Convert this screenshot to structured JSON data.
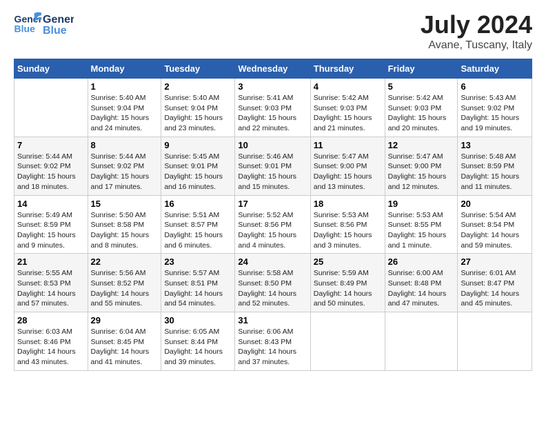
{
  "header": {
    "logo_general": "General",
    "logo_blue": "Blue",
    "month": "July 2024",
    "location": "Avane, Tuscany, Italy"
  },
  "days_of_week": [
    "Sunday",
    "Monday",
    "Tuesday",
    "Wednesday",
    "Thursday",
    "Friday",
    "Saturday"
  ],
  "weeks": [
    [
      {
        "day": "",
        "sunrise": "",
        "sunset": "",
        "daylight": ""
      },
      {
        "day": "1",
        "sunrise": "Sunrise: 5:40 AM",
        "sunset": "Sunset: 9:04 PM",
        "daylight": "Daylight: 15 hours and 24 minutes."
      },
      {
        "day": "2",
        "sunrise": "Sunrise: 5:40 AM",
        "sunset": "Sunset: 9:04 PM",
        "daylight": "Daylight: 15 hours and 23 minutes."
      },
      {
        "day": "3",
        "sunrise": "Sunrise: 5:41 AM",
        "sunset": "Sunset: 9:03 PM",
        "daylight": "Daylight: 15 hours and 22 minutes."
      },
      {
        "day": "4",
        "sunrise": "Sunrise: 5:42 AM",
        "sunset": "Sunset: 9:03 PM",
        "daylight": "Daylight: 15 hours and 21 minutes."
      },
      {
        "day": "5",
        "sunrise": "Sunrise: 5:42 AM",
        "sunset": "Sunset: 9:03 PM",
        "daylight": "Daylight: 15 hours and 20 minutes."
      },
      {
        "day": "6",
        "sunrise": "Sunrise: 5:43 AM",
        "sunset": "Sunset: 9:02 PM",
        "daylight": "Daylight: 15 hours and 19 minutes."
      }
    ],
    [
      {
        "day": "7",
        "sunrise": "Sunrise: 5:44 AM",
        "sunset": "Sunset: 9:02 PM",
        "daylight": "Daylight: 15 hours and 18 minutes."
      },
      {
        "day": "8",
        "sunrise": "Sunrise: 5:44 AM",
        "sunset": "Sunset: 9:02 PM",
        "daylight": "Daylight: 15 hours and 17 minutes."
      },
      {
        "day": "9",
        "sunrise": "Sunrise: 5:45 AM",
        "sunset": "Sunset: 9:01 PM",
        "daylight": "Daylight: 15 hours and 16 minutes."
      },
      {
        "day": "10",
        "sunrise": "Sunrise: 5:46 AM",
        "sunset": "Sunset: 9:01 PM",
        "daylight": "Daylight: 15 hours and 15 minutes."
      },
      {
        "day": "11",
        "sunrise": "Sunrise: 5:47 AM",
        "sunset": "Sunset: 9:00 PM",
        "daylight": "Daylight: 15 hours and 13 minutes."
      },
      {
        "day": "12",
        "sunrise": "Sunrise: 5:47 AM",
        "sunset": "Sunset: 9:00 PM",
        "daylight": "Daylight: 15 hours and 12 minutes."
      },
      {
        "day": "13",
        "sunrise": "Sunrise: 5:48 AM",
        "sunset": "Sunset: 8:59 PM",
        "daylight": "Daylight: 15 hours and 11 minutes."
      }
    ],
    [
      {
        "day": "14",
        "sunrise": "Sunrise: 5:49 AM",
        "sunset": "Sunset: 8:59 PM",
        "daylight": "Daylight: 15 hours and 9 minutes."
      },
      {
        "day": "15",
        "sunrise": "Sunrise: 5:50 AM",
        "sunset": "Sunset: 8:58 PM",
        "daylight": "Daylight: 15 hours and 8 minutes."
      },
      {
        "day": "16",
        "sunrise": "Sunrise: 5:51 AM",
        "sunset": "Sunset: 8:57 PM",
        "daylight": "Daylight: 15 hours and 6 minutes."
      },
      {
        "day": "17",
        "sunrise": "Sunrise: 5:52 AM",
        "sunset": "Sunset: 8:56 PM",
        "daylight": "Daylight: 15 hours and 4 minutes."
      },
      {
        "day": "18",
        "sunrise": "Sunrise: 5:53 AM",
        "sunset": "Sunset: 8:56 PM",
        "daylight": "Daylight: 15 hours and 3 minutes."
      },
      {
        "day": "19",
        "sunrise": "Sunrise: 5:53 AM",
        "sunset": "Sunset: 8:55 PM",
        "daylight": "Daylight: 15 hours and 1 minute."
      },
      {
        "day": "20",
        "sunrise": "Sunrise: 5:54 AM",
        "sunset": "Sunset: 8:54 PM",
        "daylight": "Daylight: 14 hours and 59 minutes."
      }
    ],
    [
      {
        "day": "21",
        "sunrise": "Sunrise: 5:55 AM",
        "sunset": "Sunset: 8:53 PM",
        "daylight": "Daylight: 14 hours and 57 minutes."
      },
      {
        "day": "22",
        "sunrise": "Sunrise: 5:56 AM",
        "sunset": "Sunset: 8:52 PM",
        "daylight": "Daylight: 14 hours and 55 minutes."
      },
      {
        "day": "23",
        "sunrise": "Sunrise: 5:57 AM",
        "sunset": "Sunset: 8:51 PM",
        "daylight": "Daylight: 14 hours and 54 minutes."
      },
      {
        "day": "24",
        "sunrise": "Sunrise: 5:58 AM",
        "sunset": "Sunset: 8:50 PM",
        "daylight": "Daylight: 14 hours and 52 minutes."
      },
      {
        "day": "25",
        "sunrise": "Sunrise: 5:59 AM",
        "sunset": "Sunset: 8:49 PM",
        "daylight": "Daylight: 14 hours and 50 minutes."
      },
      {
        "day": "26",
        "sunrise": "Sunrise: 6:00 AM",
        "sunset": "Sunset: 8:48 PM",
        "daylight": "Daylight: 14 hours and 47 minutes."
      },
      {
        "day": "27",
        "sunrise": "Sunrise: 6:01 AM",
        "sunset": "Sunset: 8:47 PM",
        "daylight": "Daylight: 14 hours and 45 minutes."
      }
    ],
    [
      {
        "day": "28",
        "sunrise": "Sunrise: 6:03 AM",
        "sunset": "Sunset: 8:46 PM",
        "daylight": "Daylight: 14 hours and 43 minutes."
      },
      {
        "day": "29",
        "sunrise": "Sunrise: 6:04 AM",
        "sunset": "Sunset: 8:45 PM",
        "daylight": "Daylight: 14 hours and 41 minutes."
      },
      {
        "day": "30",
        "sunrise": "Sunrise: 6:05 AM",
        "sunset": "Sunset: 8:44 PM",
        "daylight": "Daylight: 14 hours and 39 minutes."
      },
      {
        "day": "31",
        "sunrise": "Sunrise: 6:06 AM",
        "sunset": "Sunset: 8:43 PM",
        "daylight": "Daylight: 14 hours and 37 minutes."
      },
      {
        "day": "",
        "sunrise": "",
        "sunset": "",
        "daylight": ""
      },
      {
        "day": "",
        "sunrise": "",
        "sunset": "",
        "daylight": ""
      },
      {
        "day": "",
        "sunrise": "",
        "sunset": "",
        "daylight": ""
      }
    ]
  ]
}
